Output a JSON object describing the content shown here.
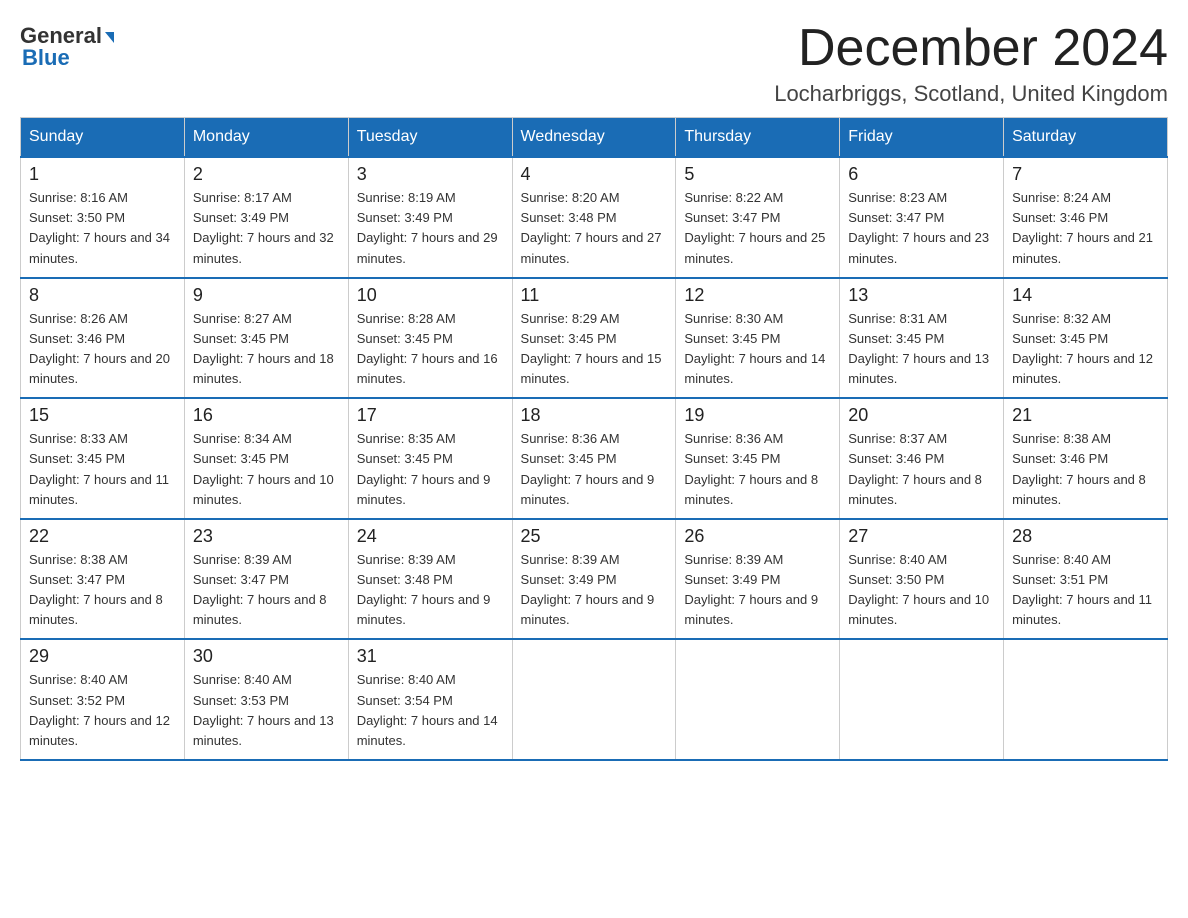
{
  "header": {
    "logo_top": "General",
    "logo_bottom": "Blue",
    "month_title": "December 2024",
    "location": "Locharbriggs, Scotland, United Kingdom"
  },
  "days_of_week": [
    "Sunday",
    "Monday",
    "Tuesday",
    "Wednesday",
    "Thursday",
    "Friday",
    "Saturday"
  ],
  "weeks": [
    [
      {
        "day": "1",
        "sunrise": "8:16 AM",
        "sunset": "3:50 PM",
        "daylight": "7 hours and 34 minutes."
      },
      {
        "day": "2",
        "sunrise": "8:17 AM",
        "sunset": "3:49 PM",
        "daylight": "7 hours and 32 minutes."
      },
      {
        "day": "3",
        "sunrise": "8:19 AM",
        "sunset": "3:49 PM",
        "daylight": "7 hours and 29 minutes."
      },
      {
        "day": "4",
        "sunrise": "8:20 AM",
        "sunset": "3:48 PM",
        "daylight": "7 hours and 27 minutes."
      },
      {
        "day": "5",
        "sunrise": "8:22 AM",
        "sunset": "3:47 PM",
        "daylight": "7 hours and 25 minutes."
      },
      {
        "day": "6",
        "sunrise": "8:23 AM",
        "sunset": "3:47 PM",
        "daylight": "7 hours and 23 minutes."
      },
      {
        "day": "7",
        "sunrise": "8:24 AM",
        "sunset": "3:46 PM",
        "daylight": "7 hours and 21 minutes."
      }
    ],
    [
      {
        "day": "8",
        "sunrise": "8:26 AM",
        "sunset": "3:46 PM",
        "daylight": "7 hours and 20 minutes."
      },
      {
        "day": "9",
        "sunrise": "8:27 AM",
        "sunset": "3:45 PM",
        "daylight": "7 hours and 18 minutes."
      },
      {
        "day": "10",
        "sunrise": "8:28 AM",
        "sunset": "3:45 PM",
        "daylight": "7 hours and 16 minutes."
      },
      {
        "day": "11",
        "sunrise": "8:29 AM",
        "sunset": "3:45 PM",
        "daylight": "7 hours and 15 minutes."
      },
      {
        "day": "12",
        "sunrise": "8:30 AM",
        "sunset": "3:45 PM",
        "daylight": "7 hours and 14 minutes."
      },
      {
        "day": "13",
        "sunrise": "8:31 AM",
        "sunset": "3:45 PM",
        "daylight": "7 hours and 13 minutes."
      },
      {
        "day": "14",
        "sunrise": "8:32 AM",
        "sunset": "3:45 PM",
        "daylight": "7 hours and 12 minutes."
      }
    ],
    [
      {
        "day": "15",
        "sunrise": "8:33 AM",
        "sunset": "3:45 PM",
        "daylight": "7 hours and 11 minutes."
      },
      {
        "day": "16",
        "sunrise": "8:34 AM",
        "sunset": "3:45 PM",
        "daylight": "7 hours and 10 minutes."
      },
      {
        "day": "17",
        "sunrise": "8:35 AM",
        "sunset": "3:45 PM",
        "daylight": "7 hours and 9 minutes."
      },
      {
        "day": "18",
        "sunrise": "8:36 AM",
        "sunset": "3:45 PM",
        "daylight": "7 hours and 9 minutes."
      },
      {
        "day": "19",
        "sunrise": "8:36 AM",
        "sunset": "3:45 PM",
        "daylight": "7 hours and 8 minutes."
      },
      {
        "day": "20",
        "sunrise": "8:37 AM",
        "sunset": "3:46 PM",
        "daylight": "7 hours and 8 minutes."
      },
      {
        "day": "21",
        "sunrise": "8:38 AM",
        "sunset": "3:46 PM",
        "daylight": "7 hours and 8 minutes."
      }
    ],
    [
      {
        "day": "22",
        "sunrise": "8:38 AM",
        "sunset": "3:47 PM",
        "daylight": "7 hours and 8 minutes."
      },
      {
        "day": "23",
        "sunrise": "8:39 AM",
        "sunset": "3:47 PM",
        "daylight": "7 hours and 8 minutes."
      },
      {
        "day": "24",
        "sunrise": "8:39 AM",
        "sunset": "3:48 PM",
        "daylight": "7 hours and 9 minutes."
      },
      {
        "day": "25",
        "sunrise": "8:39 AM",
        "sunset": "3:49 PM",
        "daylight": "7 hours and 9 minutes."
      },
      {
        "day": "26",
        "sunrise": "8:39 AM",
        "sunset": "3:49 PM",
        "daylight": "7 hours and 9 minutes."
      },
      {
        "day": "27",
        "sunrise": "8:40 AM",
        "sunset": "3:50 PM",
        "daylight": "7 hours and 10 minutes."
      },
      {
        "day": "28",
        "sunrise": "8:40 AM",
        "sunset": "3:51 PM",
        "daylight": "7 hours and 11 minutes."
      }
    ],
    [
      {
        "day": "29",
        "sunrise": "8:40 AM",
        "sunset": "3:52 PM",
        "daylight": "7 hours and 12 minutes."
      },
      {
        "day": "30",
        "sunrise": "8:40 AM",
        "sunset": "3:53 PM",
        "daylight": "7 hours and 13 minutes."
      },
      {
        "day": "31",
        "sunrise": "8:40 AM",
        "sunset": "3:54 PM",
        "daylight": "7 hours and 14 minutes."
      },
      null,
      null,
      null,
      null
    ]
  ],
  "labels": {
    "sunrise_prefix": "Sunrise: ",
    "sunset_prefix": "Sunset: ",
    "daylight_prefix": "Daylight: "
  }
}
